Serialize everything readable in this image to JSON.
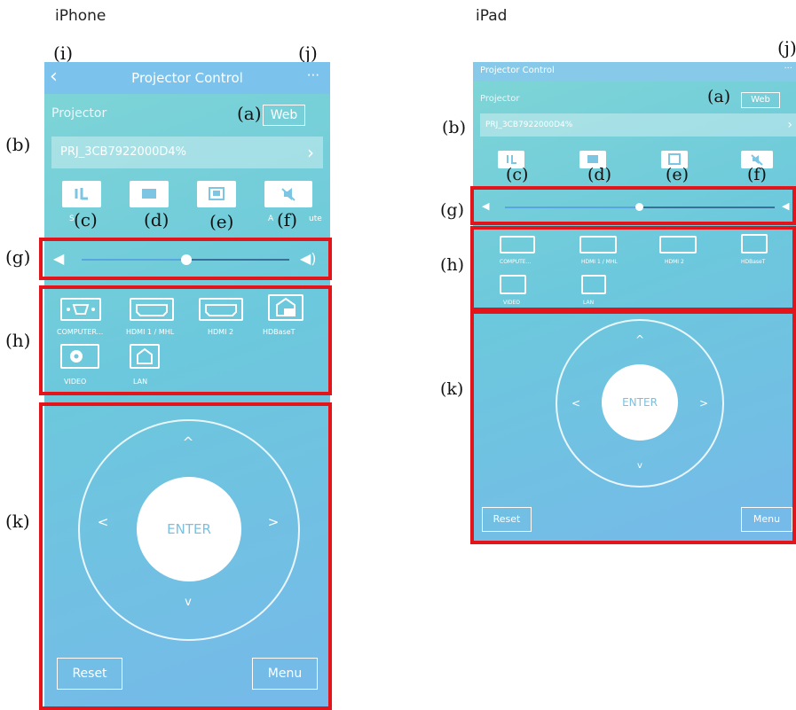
{
  "labels": {
    "iphone": "iPhone",
    "ipad": "iPad"
  },
  "callouts": {
    "a": "(a)",
    "b": "(b)",
    "c": "(c)",
    "d": "(d)",
    "e": "(e)",
    "f": "(f)",
    "g": "(g)",
    "h": "(h)",
    "i": "(i)",
    "j": "(j)",
    "k": "(k)"
  },
  "app": {
    "title": "Projector Control",
    "back_glyph": "‹",
    "more_glyph": "···",
    "section_label": "Projector",
    "web_button": "Web",
    "projector_name": "PRJ_3CB7922000D4%",
    "chevron_glyph": "›",
    "control_captions": {
      "power": "S",
      "av_mute": "A",
      "av_mute_tail": "ute"
    },
    "sources": [
      "COMPUTER...",
      "HDMI 1 / MHL",
      "HDMI 2",
      "HDBaseT",
      "VIDEO",
      "LAN"
    ],
    "ipad_sources": [
      "COMPUTE...",
      "HDMI 1 / MHL",
      "HDMI 2",
      "HDBaseT",
      "VIDEO",
      "LAN"
    ],
    "nav": {
      "enter": "ENTER",
      "up": "^",
      "down": "v",
      "left": "<",
      "right": ">"
    },
    "reset_button": "Reset",
    "menu_button": "Menu"
  },
  "colors": {
    "accent_red": "#e3151b",
    "title_bar": "#7bc3ec",
    "panel_teal": "#7fd6d6"
  }
}
